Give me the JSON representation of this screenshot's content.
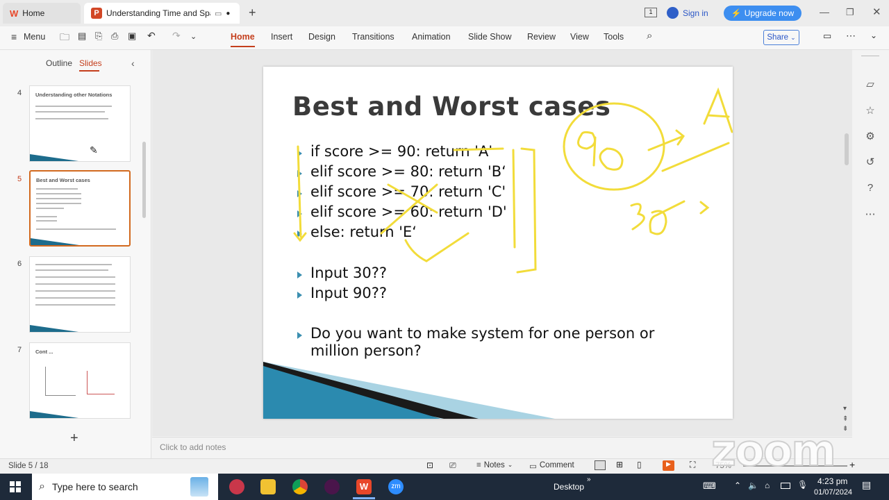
{
  "tabs": {
    "home": "Home",
    "doc": "Understanding Time and Space"
  },
  "titlebar": {
    "signin": "Sign in",
    "upgrade": "Upgrade now"
  },
  "menubar": {
    "menu": "Menu",
    "ribbon": [
      "Home",
      "Insert",
      "Design",
      "Transitions",
      "Animation",
      "Slide Show",
      "Review",
      "View",
      "Tools"
    ],
    "share": "Share"
  },
  "leftpanel": {
    "outline": "Outline",
    "slides": "Slides"
  },
  "thumbs": [
    {
      "num": "4",
      "title": "Understanding other Notations"
    },
    {
      "num": "5",
      "title": "Best and Worst cases"
    },
    {
      "num": "6",
      "title": ""
    },
    {
      "num": "7",
      "title": "Cont ..."
    }
  ],
  "slide": {
    "title": "Best and Worst cases",
    "bullets": [
      "if score >= 90: return 'A'",
      "elif score >= 80: return 'B‘",
      "elif score >= 70: return 'C'",
      "elif score >= 60: return 'D'",
      "else: return 'E‘"
    ],
    "inputs": [
      "Input 30??",
      "Input 90??"
    ],
    "question1": "Do you want to make system for one person or",
    "question2": "million person?"
  },
  "notes": {
    "placeholder": "Click to add notes"
  },
  "status": {
    "slide": "Slide 5 / 18",
    "notes": "Notes",
    "comment": "Comment",
    "zoom": "75%"
  },
  "taskbar": {
    "search": "Type here to search",
    "desktop": "Desktop",
    "time": "4:23 pm",
    "date": "01/07/2024"
  },
  "watermark": "zoom"
}
